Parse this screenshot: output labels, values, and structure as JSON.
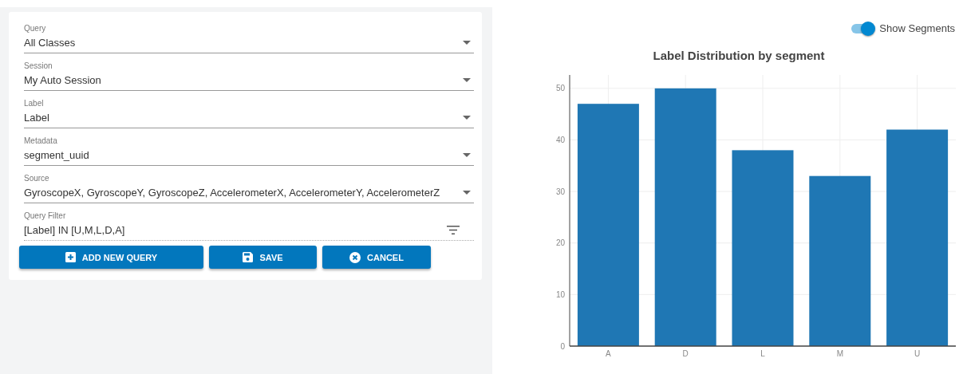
{
  "form": {
    "fields": [
      {
        "kind": "select",
        "label": "Query",
        "value": "All Classes"
      },
      {
        "kind": "select",
        "label": "Session",
        "value": "My Auto Session"
      },
      {
        "kind": "select",
        "label": "Label",
        "value": "Label"
      },
      {
        "kind": "select",
        "label": "Metadata",
        "value": "segment_uuid"
      },
      {
        "kind": "select",
        "label": "Source",
        "value": "GyroscopeX, GyroscopeY, GyroscopeZ, AccelerometerX, AccelerometerY, AccelerometerZ"
      },
      {
        "kind": "filter",
        "label": "Query Filter",
        "value": "[Label] IN [U,M,L,D,A]"
      }
    ],
    "buttons": [
      {
        "kind": "add",
        "label": "ADD NEW QUERY"
      },
      {
        "kind": "save",
        "label": "SAVE"
      },
      {
        "kind": "cancel",
        "label": "CANCEL"
      }
    ]
  },
  "toggle": {
    "label": "Show Segments",
    "on": true
  },
  "chart_data": {
    "type": "bar",
    "title": "Label Distribution by segment",
    "categories": [
      "A",
      "D",
      "L",
      "M",
      "U"
    ],
    "series": [
      {
        "color": "#1f77b4",
        "values": [
          47,
          50,
          38,
          33,
          42
        ]
      }
    ],
    "grid": true,
    "ylim": [
      0,
      52.6
    ],
    "yticks": [
      0,
      10,
      20,
      30,
      40,
      50
    ]
  }
}
